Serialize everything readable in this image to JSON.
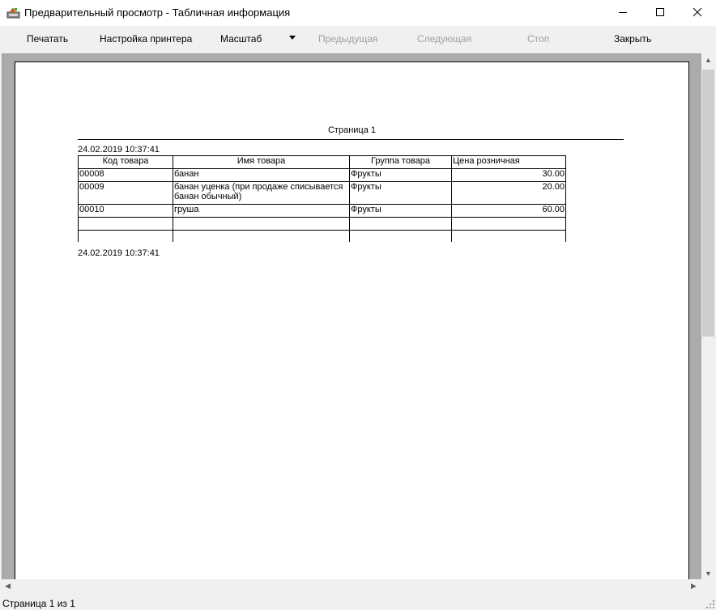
{
  "window": {
    "title": "Предварительный просмотр - Табличная информация",
    "icon": "preview-app-icon"
  },
  "toolbar": {
    "print": "Печатать",
    "printer_setup": "Настройка принтера",
    "zoom": "Масштаб",
    "previous": "Предыдущая",
    "next": "Следующая",
    "stop": "Стоп",
    "close": "Закрыть"
  },
  "report": {
    "page_header": "Страница  1",
    "date_top": "24.02.2019 10:37:41",
    "date_bottom": "24.02.2019 10:37:41",
    "columns": [
      "Код товара",
      "Имя товара",
      "Группа товара",
      "Цена розничная"
    ],
    "rows": [
      {
        "code": "00008",
        "name": "банан",
        "group": "Фрукты",
        "price": "30.00"
      },
      {
        "code": "00009",
        "name": "банан уценка (при продаже списывается банан обычный)",
        "group": "Фрукты",
        "price": "20.00"
      },
      {
        "code": "00010",
        "name": "груша",
        "group": "Фрукты",
        "price": "60.00"
      }
    ]
  },
  "status": {
    "page_info": "Страница 1 из 1"
  }
}
